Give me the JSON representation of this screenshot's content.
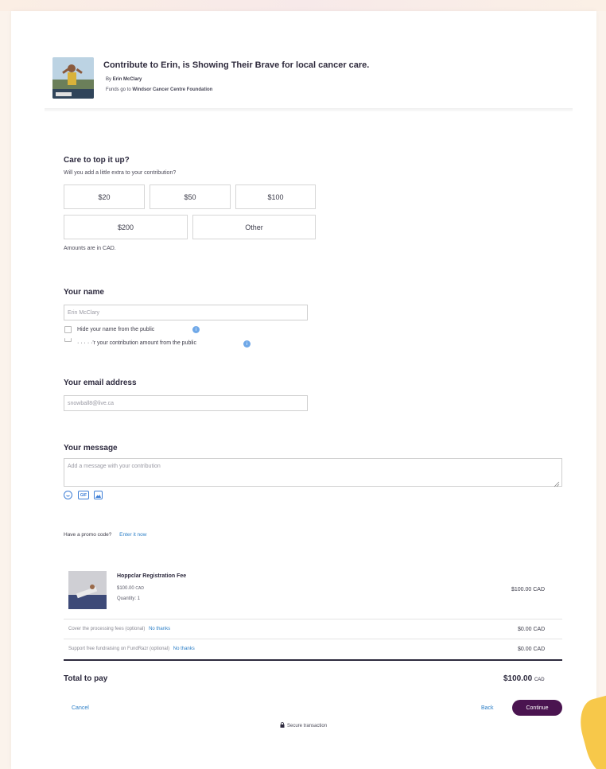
{
  "header": {
    "title": "Contribute to Erin, is Showing Their Brave for local cancer care.",
    "by_prefix": "By",
    "by_name": "Erin McClary",
    "funds_prefix": "Funds go to",
    "funds_org": "Windsor Cancer Centre Foundation"
  },
  "topup": {
    "title": "Care to top it up?",
    "subtitle": "Will you add a little extra to your contribution?",
    "amounts_row1": [
      "$20",
      "$50",
      "$100"
    ],
    "amounts_row2": [
      "$200",
      "Other"
    ],
    "note": "Amounts are in CAD."
  },
  "name_section": {
    "title": "Your name",
    "value": "Erin McClary",
    "hide_name_label": "Hide your name from the public",
    "hide_amount_label": "· · · · ·'r your contribution amount from the public"
  },
  "email_section": {
    "title": "Your email address",
    "value": "snowball8@live.ca"
  },
  "message_section": {
    "title": "Your message",
    "placeholder": "Add a message with your contribution",
    "gif_label": "GIF"
  },
  "promo": {
    "question": "Have a promo code?",
    "link": "Enter it now"
  },
  "item": {
    "name": "Hoppclar Registration Fee",
    "unit_price": "$100.00",
    "unit_currency": "CAD",
    "quantity": "Quantity: 1",
    "total": "$100.00 CAD"
  },
  "fees": [
    {
      "label": "Cover the processing fees (optional)",
      "link": "No thanks",
      "amount": "$0.00 CAD"
    },
    {
      "label": "Support free fundraising on FundRazr (optional)",
      "link": "No thanks",
      "amount": "$0.00 CAD"
    }
  ],
  "total": {
    "label": "Total to pay",
    "amount": "$100.00",
    "currency": "CAD"
  },
  "footer": {
    "cancel": "Cancel",
    "back": "Back",
    "continue": "Continue",
    "secure": "Secure transaction"
  },
  "colors": {
    "accent": "#4a1450",
    "link": "#2c7fc7",
    "blob": "#f7c84a"
  }
}
